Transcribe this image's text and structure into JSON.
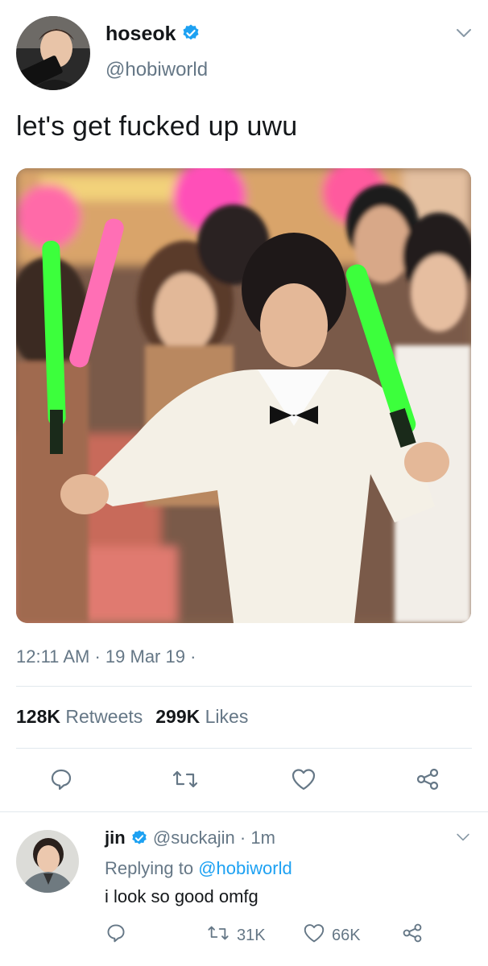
{
  "tweet": {
    "display_name": "hoseok",
    "handle": "@hobiworld",
    "text": "let's get fucked up uwu",
    "time": "12:11 AM",
    "date": "19 Mar 19",
    "retweets_count": "128K",
    "retweets_label": "Retweets",
    "likes_count": "299K",
    "likes_label": "Likes",
    "icons": [
      "verified-badge-icon",
      "chevron-down-icon",
      "reply-icon",
      "retweet-icon",
      "like-icon",
      "share-icon"
    ]
  },
  "reply": {
    "display_name": "jin",
    "handle": "@suckajin",
    "time_ago": "1m",
    "replying_prefix": "Replying to",
    "replying_handle": "@hobiworld",
    "text": "i look so good omfg",
    "retweets": "31K",
    "likes": "66K"
  },
  "colors": {
    "accent": "#1da1f2",
    "text_primary": "#14171a",
    "text_secondary": "#657786",
    "divider": "#e1e8ed"
  }
}
